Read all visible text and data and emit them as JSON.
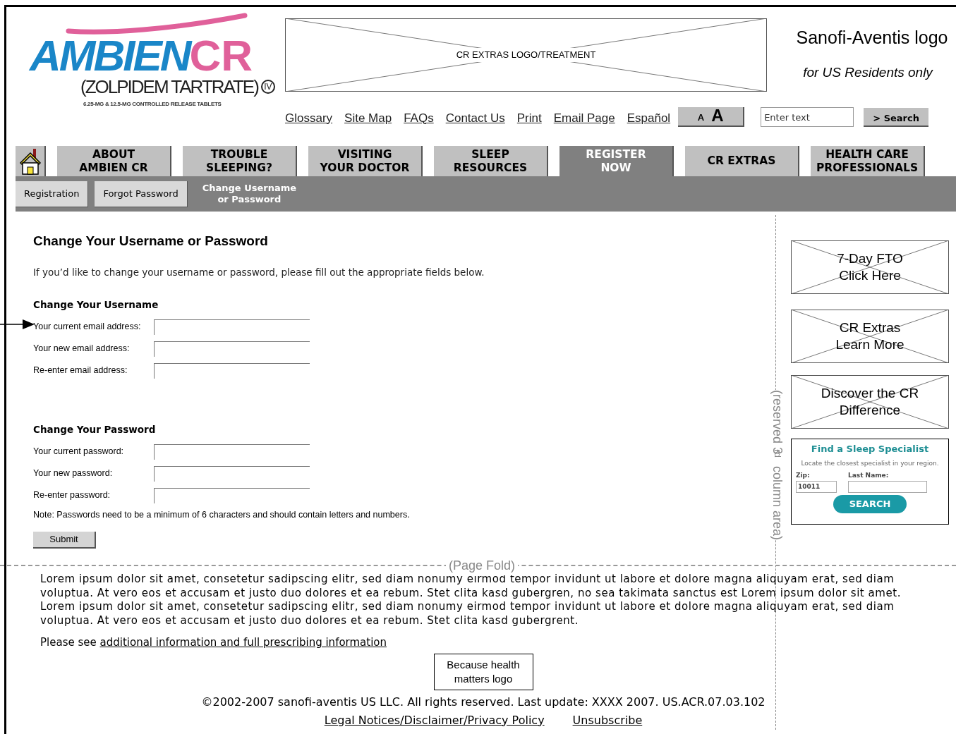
{
  "header": {
    "logo": {
      "brand": "AMBIEN",
      "brand_suffix": "CR",
      "generic": "(ZOLPIDEM TARTRATE)",
      "schedule": "IV",
      "tagline": "6.25-MG & 12.5-MG CONTROLLED RELEASE TABLETS"
    },
    "banner_placeholder": "CR EXTRAS LOGO/TREATMENT",
    "company_logo": "Sanofi-Aventis logo",
    "residency_note": "for US Residents only",
    "utility_links": [
      "Glossary",
      "Site Map",
      "FAQs",
      "Contact Us",
      "Print",
      "Email Page",
      "Español"
    ],
    "text_size": {
      "small": "A",
      "large": "A"
    },
    "search": {
      "placeholder": "Enter text",
      "button": "> Search"
    }
  },
  "nav_tabs": [
    {
      "label": "ABOUT\nAMBIEN CR",
      "selected": false
    },
    {
      "label": "TROUBLE\nSLEEPING?",
      "selected": false
    },
    {
      "label": "VISITING\nYOUR DOCTOR",
      "selected": false
    },
    {
      "label": "SLEEP\nRESOURCES",
      "selected": false
    },
    {
      "label": "REGISTER\nNOW",
      "selected": true
    },
    {
      "label": "CR EXTRAS",
      "selected": false
    },
    {
      "label": "HEALTH CARE\nPROFESSIONALS",
      "selected": false
    }
  ],
  "sub_tabs": [
    {
      "label": "Registration",
      "selected": false
    },
    {
      "label": "Forgot Password",
      "selected": false
    },
    {
      "label": "Change Username\nor Password",
      "selected": true
    }
  ],
  "content": {
    "title": "Change Your Username or Password",
    "intro": "If you’d like to change your username or password, please fill out the appropriate fields below.",
    "sections": [
      {
        "heading": "Change Your Username",
        "fields": [
          "Your current email address:",
          "Your new email address:",
          "Re-enter email address:"
        ]
      },
      {
        "heading": "Change Your Password",
        "fields": [
          "Your current password:",
          "Your new password:",
          "Re-enter password:"
        ]
      }
    ],
    "note": "Note:  Passwords need to be a minimum of 6 characters and should contain letters and numbers.",
    "submit": "Submit"
  },
  "sidebar": {
    "promos": [
      "7-Day FTO\nClick Here",
      "CR Extras\nLearn More",
      "Discover the CR\nDifference"
    ],
    "specialist": {
      "title": "Find a Sleep Specialist",
      "subtitle": "Locate the closest specialist in your region.",
      "zip_label": "Zip:",
      "zip_value": "10011",
      "name_label": "Last Name:",
      "button": "SEARCH"
    }
  },
  "annotations": {
    "page_fold": "(Page Fold)",
    "column_note": "(reserved 3$^{rd}$ column area)"
  },
  "footer": {
    "body": "Lorem ipsum dolor sit amet, consetetur sadipscing elitr, sed diam nonumy eirmod tempor invidunt ut labore et dolore magna aliquyam erat, sed diam voluptua. At vero eos et accusam et justo duo dolores et ea rebum. Stet clita kasd gubergren, no sea takimata sanctus est Lorem ipsum dolor sit amet. Lorem ipsum dolor sit amet, consetetur sadipscing elitr, sed diam nonumy eirmod tempor invidunt ut labore et dolore magna aliquyam erat, sed diam voluptua. At vero eos et accusam et justo duo dolores et ea rebum. Stet clita kasd gubergrent.",
    "see_prefix": "Please see ",
    "see_link": "additional information and full prescribing information",
    "partner_logo": "Because health\nmatters logo",
    "copyright": "©2002-2007 sanofi-aventis US LLC. All rights reserved.  Last update: XXXX 2007.  US.ACR.07.03.102",
    "links": [
      "Legal Notices/Disclaimer/Privacy Policy",
      "Unsubscribe"
    ]
  }
}
